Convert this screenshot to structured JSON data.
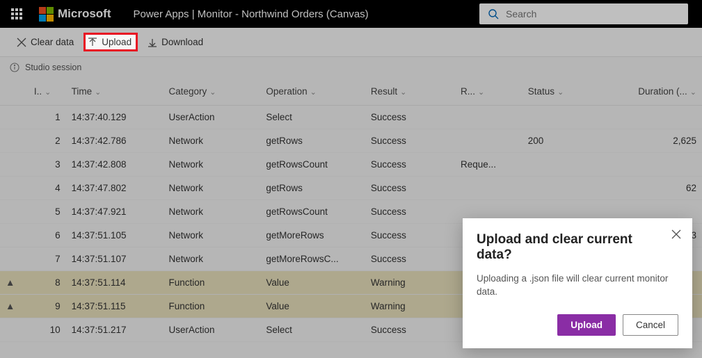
{
  "topbar": {
    "brand": "Microsoft",
    "title": "Power Apps  |  Monitor - Northwind Orders (Canvas)",
    "search_placeholder": "Search"
  },
  "toolbar": {
    "clear": "Clear data",
    "upload": "Upload",
    "download": "Download"
  },
  "session_label": "Studio session",
  "columns": {
    "id": "I..",
    "time": "Time",
    "category": "Category",
    "operation": "Operation",
    "result": "Result",
    "r": "R...",
    "status": "Status",
    "duration": "Duration (..."
  },
  "rows": [
    {
      "warn": "",
      "id": "1",
      "time": "14:37:40.129",
      "category": "UserAction",
      "operation": "Select",
      "result": "Success",
      "r": "",
      "status": "",
      "duration": ""
    },
    {
      "warn": "",
      "id": "2",
      "time": "14:37:42.786",
      "category": "Network",
      "operation": "getRows",
      "result": "Success",
      "r": "",
      "status": "200",
      "duration": "2,625"
    },
    {
      "warn": "",
      "id": "3",
      "time": "14:37:42.808",
      "category": "Network",
      "operation": "getRowsCount",
      "result": "Success",
      "r": "Reque...",
      "status": "",
      "duration": ""
    },
    {
      "warn": "",
      "id": "4",
      "time": "14:37:47.802",
      "category": "Network",
      "operation": "getRows",
      "result": "Success",
      "r": "",
      "status": "",
      "duration": "62"
    },
    {
      "warn": "",
      "id": "5",
      "time": "14:37:47.921",
      "category": "Network",
      "operation": "getRowsCount",
      "result": "Success",
      "r": "",
      "status": "",
      "duration": ""
    },
    {
      "warn": "",
      "id": "6",
      "time": "14:37:51.105",
      "category": "Network",
      "operation": "getMoreRows",
      "result": "Success",
      "r": "",
      "status": "",
      "duration": "93"
    },
    {
      "warn": "",
      "id": "7",
      "time": "14:37:51.107",
      "category": "Network",
      "operation": "getMoreRowsC...",
      "result": "Success",
      "r": "",
      "status": "",
      "duration": ""
    },
    {
      "warn": "▲",
      "id": "8",
      "time": "14:37:51.114",
      "category": "Function",
      "operation": "Value",
      "result": "Warning",
      "r": "",
      "status": "",
      "duration": ""
    },
    {
      "warn": "▲",
      "id": "9",
      "time": "14:37:51.115",
      "category": "Function",
      "operation": "Value",
      "result": "Warning",
      "r": "",
      "status": "",
      "duration": ""
    },
    {
      "warn": "",
      "id": "10",
      "time": "14:37:51.217",
      "category": "UserAction",
      "operation": "Select",
      "result": "Success",
      "r": "",
      "status": "",
      "duration": ""
    }
  ],
  "dialog": {
    "title": "Upload and clear current data?",
    "body": "Uploading a .json file will clear current monitor data.",
    "primary": "Upload",
    "secondary": "Cancel"
  },
  "brand_colors": {
    "r": "#f25022",
    "g": "#7fba00",
    "b": "#00a4ef",
    "y": "#ffb900"
  }
}
